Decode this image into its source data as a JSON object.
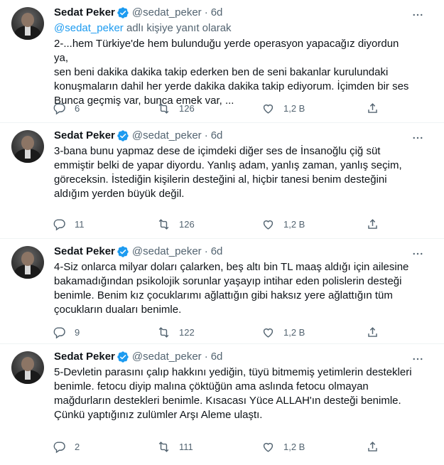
{
  "colors": {
    "accent": "#1d9bf0",
    "secondary_text": "#536471",
    "primary_text": "#0f1419"
  },
  "icons": {
    "verified": "verified-badge-icon",
    "more": "more-icon",
    "reply": "reply-icon",
    "retweet": "retweet-icon",
    "like": "like-icon",
    "share": "share-icon"
  },
  "tweets": [
    {
      "name": "Sedat Peker",
      "handle": "@sedat_peker",
      "dot": "·",
      "time": "6d",
      "reply_mention": "@sedat_peker",
      "reply_suffix": " adlı kişiye yanıt olarak",
      "text": "2-...hem Türkiye'de hem bulunduğu yerde operasyon yapacağız diyordun ya,\nsen beni dakika dakika takip ederken ben de seni bakanlar kurulundaki\nkonuşmaların dahil her yerde dakika dakika takip ediyorum. İçimden bir ses\nBunca geçmiş var, bunca emek var, ...",
      "replies": "6",
      "retweets": "126",
      "likes": "1,2 B"
    },
    {
      "name": "Sedat Peker",
      "handle": "@sedat_peker",
      "dot": "·",
      "time": "6d",
      "text": "3-bana bunu yapmaz dese de içimdeki diğer ses de İnsanoğlu çiğ süt\nemmiştir belki de yapar diyordu. Yanlış adam, yanlış zaman, yanlış seçim,\ngöreceksin. İstediğin kişilerin desteğini al, hiçbir tanesi benim desteğini\naldığım yerden büyük değil.",
      "replies": "11",
      "retweets": "126",
      "likes": "1,2 B"
    },
    {
      "name": "Sedat Peker",
      "handle": "@sedat_peker",
      "dot": "·",
      "time": "6d",
      "text": "4-Siz onlarca milyar doları çalarken, beş altı bin TL maaş aldığı için ailesine\nbakamadığından psikolojik sorunlar yaşayıp intihar eden polislerin desteği\nbenimle. Benim kız çocuklarımı ağlattığın gibi haksız yere ağlattığın tüm\nçocukların duaları benimle.",
      "replies": "9",
      "retweets": "122",
      "likes": "1,2 B"
    },
    {
      "name": "Sedat Peker",
      "handle": "@sedat_peker",
      "dot": "·",
      "time": "6d",
      "text": "5-Devletin parasını çalıp hakkını yediğin, tüyü bitmemiş yetimlerin destekleri\nbenimle. fetocu diyip malına çöktüğün ama aslında fetocu olmayan\nmağdurların destekleri benimle. Kısacası Yüce ALLAH'ın desteği benimle.\nÇünkü yaptığınız zulümler Arşı Aleme ulaştı.",
      "replies": "2",
      "retweets": "111",
      "likes": "1,2 B"
    }
  ]
}
